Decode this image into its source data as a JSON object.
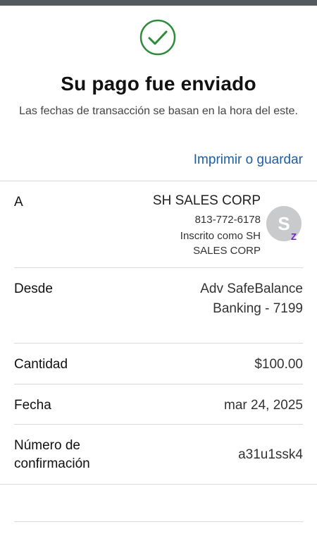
{
  "header": {
    "title": "Su pago fue enviado",
    "subtitle": "Las fechas de transacción se basan en la hora del este.",
    "print_label": "Imprimir o guardar"
  },
  "recipient": {
    "label": "A",
    "name": "SH SALES CORP",
    "phone": "813-772-6178",
    "enrolled_as": "Inscrito como SH SALES CORP",
    "avatar_initial": "S",
    "badge": "Z"
  },
  "from": {
    "label": "Desde",
    "value": "Adv SafeBalance Banking - 7199"
  },
  "amount": {
    "label": "Cantidad",
    "value": "$100.00"
  },
  "date": {
    "label": "Fecha",
    "value": "mar 24, 2025"
  },
  "confirmation": {
    "label": "Número de confirmación",
    "value": "a31u1ssk4"
  },
  "colors": {
    "success": "#2e8b3a",
    "link": "#1a5fa6",
    "zelle": "#6d1ed4",
    "avatar": "#c9cacc"
  }
}
